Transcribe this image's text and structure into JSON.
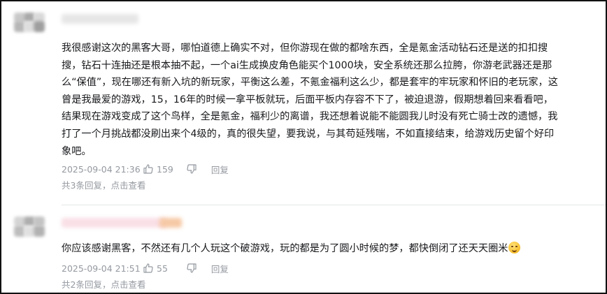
{
  "comments": [
    {
      "lines": [
        "我很感谢这次的黑客大哥，哪怕道德上确实不对，但你游现在做的都啥东西，全是氪金活动钻石还是送的扣扣搜",
        "搜，钻石十连抽还是根本抽不起，一个ai生成换皮角色能买个1000块，安全系统还那么拉胯，你游老武器还是那",
        "么“保值”，现在哪还有新入坑的新玩家，平衡这么差，不氪金福利这么少，都是套牢的牢玩家和怀旧的老玩家，这",
        "曾是我最爱的游戏，15，16年的时候一拿平板就玩，后面平板内存容不下了，被迫退游，假期想着回来看看吧，",
        "结果现在游戏变成了这个鸟样，全是氪金，福利少的离谱，我还想着说能不能圆我儿时没有死亡骑士改的遗憾，我",
        "打了一个月挑战都没刷出来个4级的，真的很失望，要我说，与其苟延残喘，不如直接结束，给游戏历史留个好印",
        "象吧。"
      ],
      "time": "2025-09-04 21:36",
      "likes": "159",
      "reply_label": "回复",
      "sub_count_text": "共3条回复，",
      "view_label": "点击查看"
    },
    {
      "lines": [
        "你应该感谢黑客，不然还有几个人玩这个破游戏，玩的都是为了圆小时候的梦，都快倒闭了还天天圈米"
      ],
      "emoji": "face-emoji",
      "time": "2025-09-04 21:51",
      "likes": "55",
      "reply_label": "回复",
      "sub_count_text": "共2条回复，",
      "view_label": "点击查看"
    }
  ],
  "colors": {
    "text": "#18191c",
    "meta": "#9499a0",
    "divider": "#e3e5e7",
    "frame": "#111111"
  },
  "icons": {
    "like": "thumb-up-icon",
    "dislike": "thumb-down-icon"
  }
}
